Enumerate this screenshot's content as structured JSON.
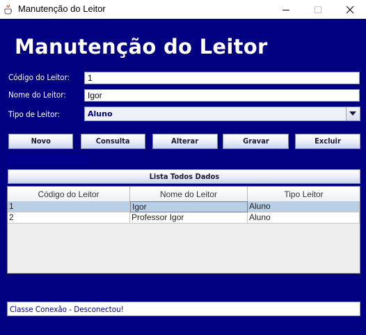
{
  "window": {
    "title": "Manutenção do Leitor"
  },
  "heading": "Manutenção do Leitor",
  "form": {
    "codigo_label": "Código do Leitor:",
    "codigo_value": "1",
    "nome_label": "Nome do Leitor:",
    "nome_value": "Igor",
    "tipo_label": "Tipo de Leitor:",
    "tipo_value": "Aluno"
  },
  "buttons": {
    "novo": "Novo",
    "consulta": "Consulta",
    "alterar": "Alterar",
    "gravar": "Gravar",
    "excluir": "Excluir",
    "lista": "Lista Todos Dados"
  },
  "table": {
    "columns": [
      "Código do Leitor",
      "Nome do Leitor",
      "Tipo Leitor"
    ],
    "rows": [
      [
        "1",
        "Igor",
        "Aluno"
      ],
      [
        "2",
        "Professor Igor",
        "Aluno"
      ]
    ],
    "selected_row": 0
  },
  "status": "Classe Conexão - Desconectou!",
  "colors": {
    "background": "#000080",
    "selection": "#b8cfe5",
    "label_text": "#ffffff"
  }
}
